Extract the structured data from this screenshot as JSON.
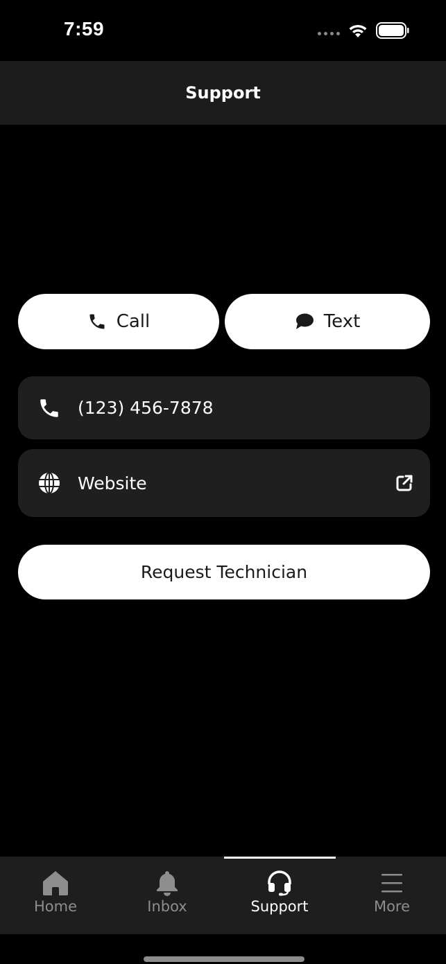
{
  "status_bar": {
    "time": "7:59",
    "icons": [
      "signal-dots-icon",
      "wifi-icon",
      "battery-icon"
    ]
  },
  "header": {
    "title": "Support"
  },
  "actions": {
    "call_label": "Call",
    "call_icon": "phone-icon",
    "text_label": "Text",
    "text_icon": "chat-bubble-icon"
  },
  "contact_rows": {
    "phone": {
      "label": "(123) 456-7878",
      "icon": "phone-icon"
    },
    "website": {
      "label": "Website",
      "icon": "globe-icon",
      "trailing_icon": "external-link-icon"
    }
  },
  "request_button": {
    "label": "Request Technician"
  },
  "tab_bar": {
    "tabs": [
      {
        "label": "Home",
        "icon": "home-icon",
        "active": false
      },
      {
        "label": "Inbox",
        "icon": "bell-icon",
        "active": false
      },
      {
        "label": "Support",
        "icon": "headset-icon",
        "active": true
      },
      {
        "label": "More",
        "icon": "hamburger-menu-icon",
        "active": false
      }
    ]
  },
  "colors": {
    "background": "#000000",
    "header_background": "#1c1c1c",
    "row_background": "#1f1f1f",
    "tab_bar_background": "#1e1e1e",
    "pill_background": "#ffffff",
    "inactive_tab": "#8e8e8e",
    "active_tab": "#ffffff"
  }
}
